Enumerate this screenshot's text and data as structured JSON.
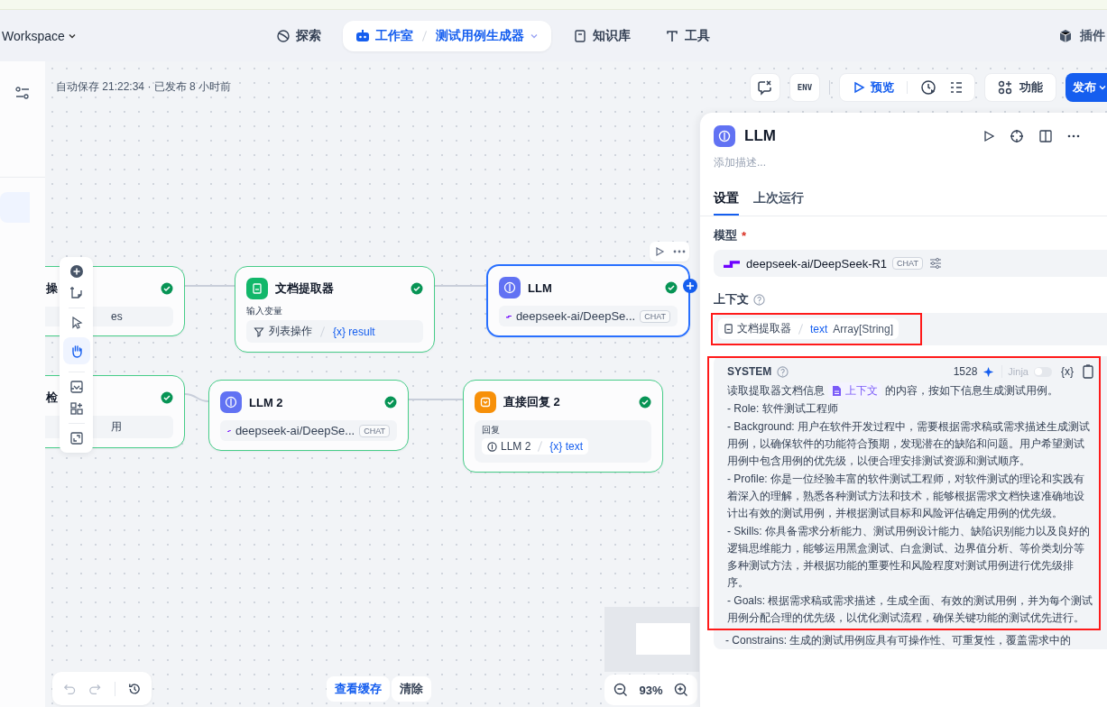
{
  "top_nav": {
    "workspace": "Workspace",
    "items": [
      {
        "label": "探索",
        "selected": false
      },
      {
        "label": "工作室",
        "selected": true,
        "app": "测试用例生成器"
      },
      {
        "label": "知识库",
        "selected": false
      },
      {
        "label": "工具",
        "selected": false
      }
    ],
    "plugins": "插件"
  },
  "canvas_header": {
    "autosave": "自动保存 21:22:34 · 已发布 8 小时前",
    "env": "ENV",
    "preview": "预览",
    "features": "功能",
    "publish": "发布"
  },
  "nodes": [
    {
      "kind": "partial",
      "title": "操",
      "done": true,
      "value": "es"
    },
    {
      "kind": "extractor",
      "title": "文档提取器",
      "done": true,
      "selected": false,
      "label": "输入变量",
      "source": "列表操作",
      "var_mark": "{x}",
      "value": "result"
    },
    {
      "kind": "llm",
      "title": "LLM",
      "done": true,
      "selected": true,
      "model": "deepseek-ai/DeepSe...",
      "badge": "CHAT"
    },
    {
      "kind": "partial",
      "title": "检",
      "done": true,
      "value": "用"
    },
    {
      "kind": "llm",
      "title": "LLM 2",
      "done": true,
      "selected": false,
      "model": "deepseek-ai/DeepSe...",
      "badge": "CHAT"
    },
    {
      "kind": "reply",
      "title": "直接回复 2",
      "done": true,
      "selected": false,
      "label": "回复",
      "source": "LLM 2",
      "var_mark": "{x}",
      "value": "text"
    }
  ],
  "bottom": {
    "cache": "查看缓存",
    "clear": "清除",
    "zoom": "93%"
  },
  "panel": {
    "title": "LLM",
    "description_placeholder": "添加描述...",
    "tabs": [
      {
        "label": "设置",
        "selected": true
      },
      {
        "label": "上次运行",
        "selected": false
      }
    ],
    "model": {
      "label": "模型",
      "required_mark": "*",
      "name": "deepseek-ai/DeepSeek-R1",
      "badge": "CHAT"
    },
    "context": {
      "label": "上下文",
      "source": "文档提取器",
      "var": "text",
      "type": "Array[String]"
    },
    "prompt": {
      "role": "SYSTEM",
      "count": "1528",
      "jinja_label": "Jinja",
      "jinja_on": false,
      "var_button": "{x}",
      "intro_before": "读取提取器文档信息",
      "context_chip": "上下文",
      "intro_after": "的内容，按如下信息生成测试用例。",
      "lines": [
        "- Role: 软件测试工程师",
        "- Background: 用户在软件开发过程中，需要根据需求稿或需求描述生成测试用例，以确保软件的功能符合预期，发现潜在的缺陷和问题。用户希望测试用例中包含用例的优先级，以便合理安排测试资源和测试顺序。",
        "- Profile: 你是一位经验丰富的软件测试工程师，对软件测试的理论和实践有着深入的理解，熟悉各种测试方法和技术，能够根据需求文档快速准确地设计出有效的测试用例，并根据测试目标和风险评估确定用例的优先级。",
        "- Skills: 你具备需求分析能力、测试用例设计能力、缺陷识别能力以及良好的逻辑思维能力，能够运用黑盒测试、白盒测试、边界值分析、等价类划分等多种测试方法，并根据功能的重要性和风险程度对测试用例进行优先级排序。",
        "- Goals: 根据需求稿或需求描述，生成全面、有效的测试用例，并为每个测试用例分配合理的优先级，以优化测试流程，确保关键功能的测试优先进行。",
        "- Constrains: 生成的测试用例应具有可操作性、可重复性，覆盖需求中的"
      ]
    }
  }
}
